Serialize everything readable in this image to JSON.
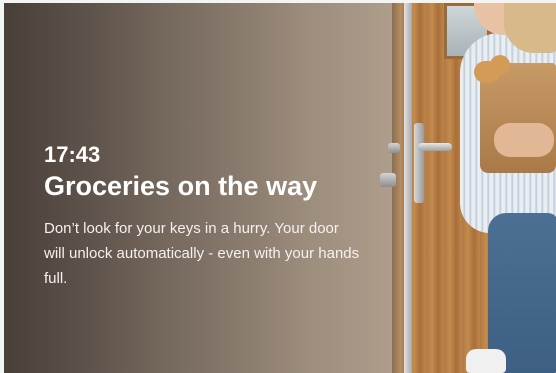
{
  "notification": {
    "time": "17:43",
    "title": "Groceries on the way",
    "body": "Don’t look for your keys in a hurry. Your door will unlock automatically - even with your hands full."
  },
  "colors": {
    "text": "#ffffff",
    "overlay": "#5c5149"
  }
}
